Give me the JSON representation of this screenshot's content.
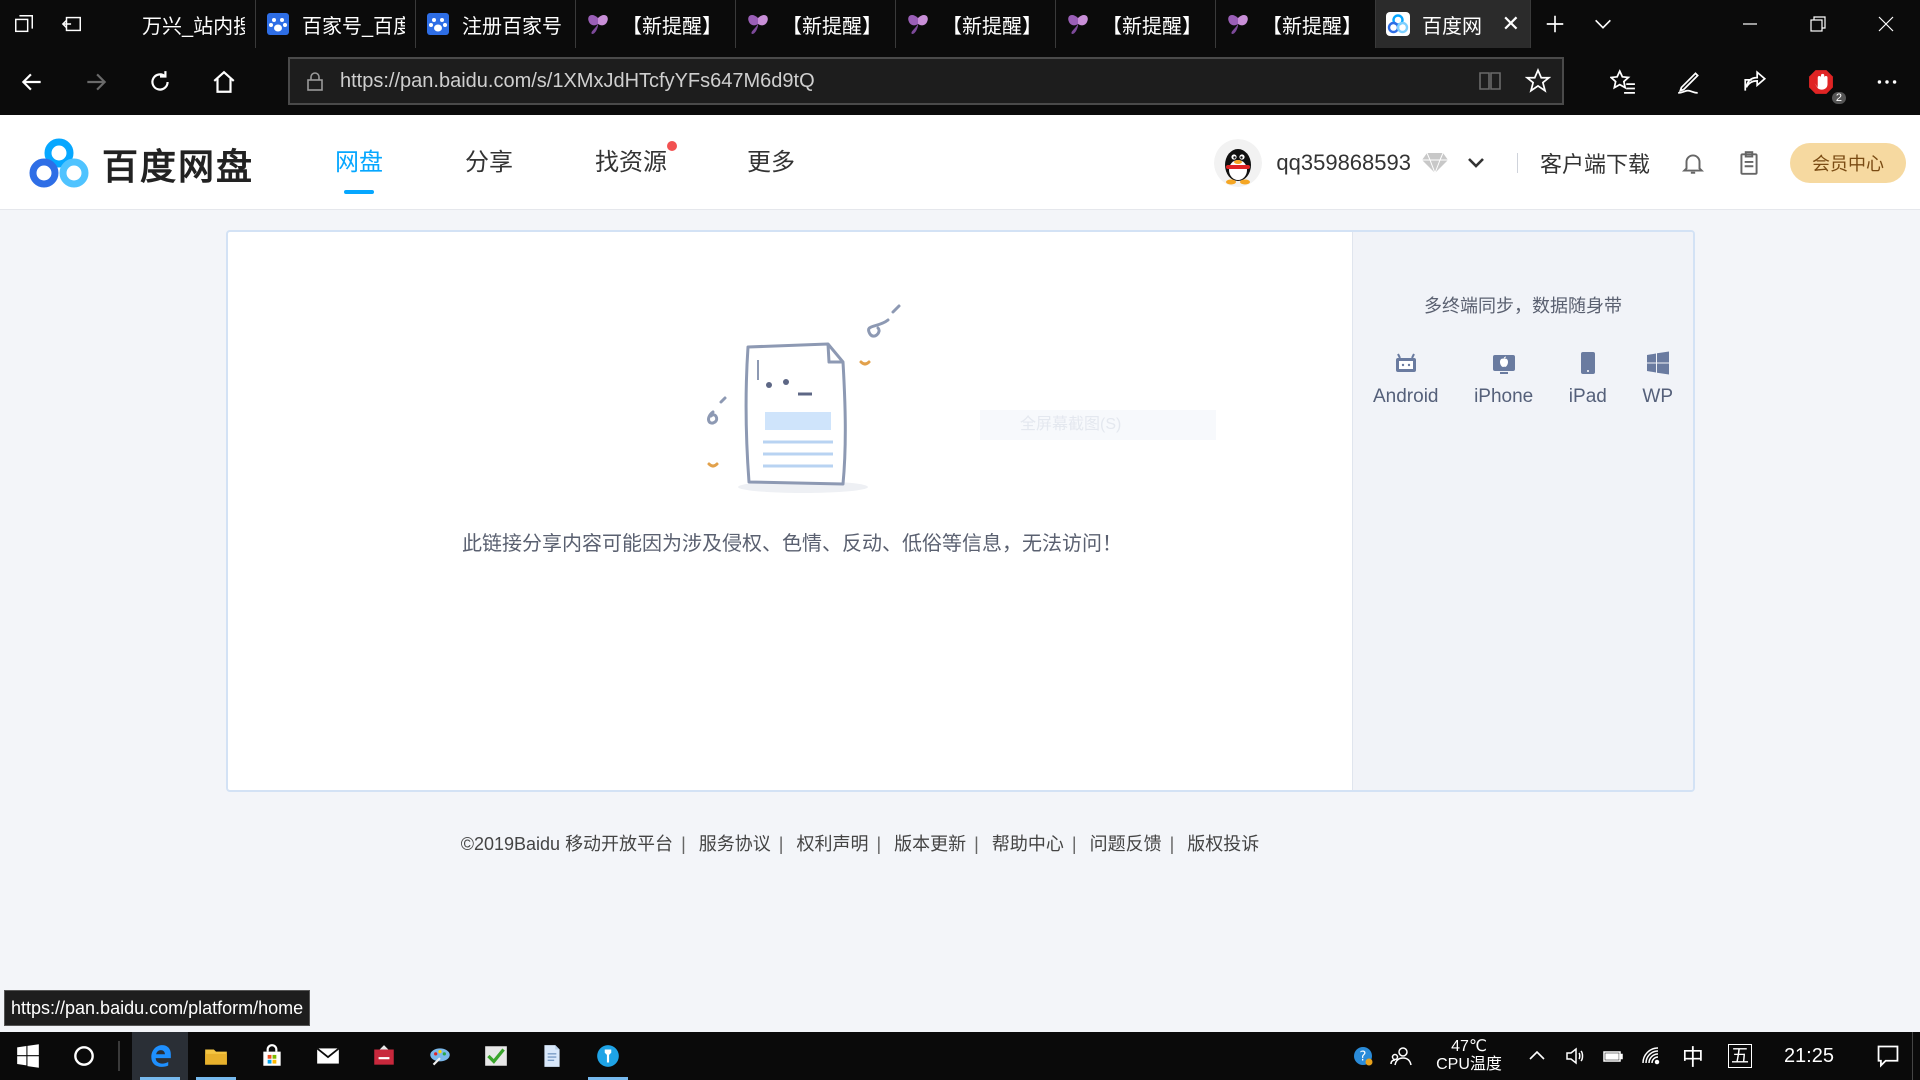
{
  "browser": {
    "tabs": [
      {
        "title": "万兴_站内搜",
        "icon": "blank-page-icon"
      },
      {
        "title": "百家号_百度",
        "icon": "baidu-paw-icon"
      },
      {
        "title": "注册百家号",
        "icon": "baidu-paw-icon"
      },
      {
        "title": "【新提醒】",
        "icon": "butterfly-icon"
      },
      {
        "title": "【新提醒】",
        "icon": "butterfly-icon"
      },
      {
        "title": "【新提醒】",
        "icon": "butterfly-icon"
      },
      {
        "title": "【新提醒】",
        "icon": "butterfly-icon"
      },
      {
        "title": "【新提醒】",
        "icon": "butterfly-icon"
      },
      {
        "title": "百度网",
        "icon": "baidu-pan-icon",
        "active": true
      }
    ],
    "url": "https://pan.baidu.com/s/1XMxJdHTcfyYFs647M6d9tQ",
    "extension_badge": "2",
    "status_url": "https://pan.baidu.com/platform/home"
  },
  "header": {
    "logo_text": "百度网盘",
    "nav": [
      {
        "label": "网盘",
        "active": true
      },
      {
        "label": "分享"
      },
      {
        "label": "找资源",
        "dot": true
      },
      {
        "label": "更多"
      }
    ],
    "username": "qq359868593",
    "client_download": "客户端下载",
    "vip_center": "会员中心"
  },
  "main": {
    "error_message": "此链接分享内容可能因为涉及侵权、色情、反动、低俗等信息，无法访问！",
    "ghost_tooltip": "全屏幕截图(S)",
    "side": {
      "title": "多终端同步，数据随身带",
      "platforms": [
        {
          "label": "Android",
          "icon": "android-icon"
        },
        {
          "label": "iPhone",
          "icon": "apple-icon"
        },
        {
          "label": "iPad",
          "icon": "tablet-icon"
        },
        {
          "label": "WP",
          "icon": "windows-icon"
        }
      ]
    }
  },
  "footer": {
    "copyright": "©2019Baidu",
    "links": [
      "移动开放平台",
      "服务协议",
      "权利声明",
      "版本更新",
      "帮助中心",
      "问题反馈",
      "版权投诉"
    ]
  },
  "taskbar": {
    "cpu_temp": "47℃",
    "cpu_label": "CPU温度",
    "ime": "中",
    "ime2": "五",
    "time": "21:25"
  },
  "colors": {
    "accent": "#06a7ff",
    "vip_bg": "#f6d9a0",
    "page_bg": "#f3f5f9"
  }
}
